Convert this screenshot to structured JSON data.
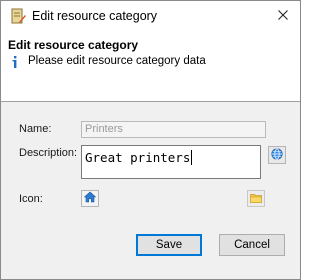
{
  "window": {
    "title": "Edit resource category",
    "close_glyph": "✕"
  },
  "header": {
    "heading": "Edit resource category",
    "subtitle": "Please edit resource category data"
  },
  "form": {
    "name_label": "Name:",
    "name_value": "Printers",
    "description_label": "Description:",
    "description_value": "Great printers",
    "icon_label": "Icon:"
  },
  "buttons": {
    "save": "Save",
    "cancel": "Cancel"
  },
  "icons": {
    "app": "edit-document-icon",
    "info": "info-icon",
    "globe": "globe-icon",
    "home": "home-icon",
    "folder": "folder-icon",
    "close": "close-icon"
  },
  "colors": {
    "accent": "#0078d7",
    "header_bg": "#ffffff",
    "body_bg": "#f0f0f0"
  }
}
